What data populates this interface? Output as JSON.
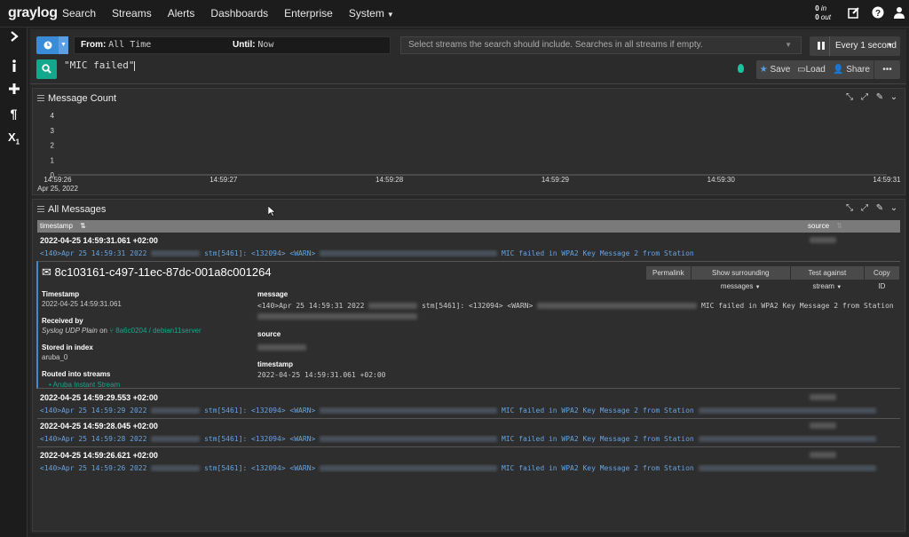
{
  "nav": {
    "logo_main": "gray",
    "logo_accent": "log",
    "items": [
      "Search",
      "Streams",
      "Alerts",
      "Dashboards",
      "Enterprise",
      "System"
    ],
    "throughput_in": "0",
    "throughput_in_label": "in",
    "throughput_out": "0",
    "throughput_out_label": "out"
  },
  "search": {
    "from_label": "From:",
    "from_value": "All Time",
    "until_label": "Until:",
    "until_value": "Now",
    "streams_placeholder": "Select streams the search should include. Searches in all streams if empty.",
    "refresh_label": "Every 1 second",
    "query": "\"MIC failed\"",
    "save_label": "Save",
    "load_label": "Load",
    "share_label": "Share",
    "more_label": "•••"
  },
  "message_count": {
    "title": "Message Count"
  },
  "chart_data": {
    "type": "line",
    "title": "Message Count",
    "y_ticks": [
      "4",
      "3",
      "2",
      "1",
      "0"
    ],
    "ylim": [
      0,
      4
    ],
    "x_ticks": [
      "14:59:26",
      "14:59:27",
      "14:59:28",
      "14:59:29",
      "14:59:30",
      "14:59:31"
    ],
    "x_subtitle": "Apr 25, 2022",
    "series": []
  },
  "all_messages": {
    "title": "All Messages",
    "col_timestamp": "timestamp",
    "col_source": "source",
    "first_row": {
      "timestamp": "2022-04-25 14:59:31.061 +02:00",
      "msg_start": "<140>Apr 25 14:59:31 2022",
      "msg_mid": "stm[5461]: <132094> <WARN>",
      "msg_tail": "MIC failed in WPA2 Key Message 2 from Station"
    },
    "detail": {
      "id": "8c103161-c497-11ec-87dc-001a8c001264",
      "buttons": [
        "Permalink",
        "Show surrounding messages",
        "Test against stream",
        "Copy ID"
      ],
      "timestamp_label": "Timestamp",
      "timestamp_value": "2022-04-25 14:59:31.061",
      "received_label": "Received by",
      "received_input": "Syslog UDP Plain",
      "received_on": "on",
      "received_node": "8a6c0204 / debian11server",
      "stored_label": "Stored in index",
      "stored_value": "aruba_0",
      "routed_label": "Routed into streams",
      "routed_stream": "Aruba Instant Stream",
      "message_label": "message",
      "message_start": "<140>Apr 25 14:59:31 2022",
      "message_mid": "stm[5461]: <132094> <WARN>",
      "message_tail": "MIC failed in WPA2 Key Message 2 from Station",
      "source_label": "source",
      "ts_label": "timestamp",
      "ts_value": "2022-04-25 14:59:31.061 +02:00"
    },
    "rows": [
      {
        "timestamp": "2022-04-25 14:59:29.553 +02:00",
        "msg_start": "<140>Apr 25 14:59:29 2022",
        "msg_mid": "stm[5461]: <132094> <WARN>",
        "msg_tail": "MIC failed in WPA2 Key Message 2 from Station"
      },
      {
        "timestamp": "2022-04-25 14:59:28.045 +02:00",
        "msg_start": "<140>Apr 25 14:59:28 2022",
        "msg_mid": "stm[5461]: <132094> <WARN>",
        "msg_tail": "MIC failed in WPA2 Key Message 2 from Station"
      },
      {
        "timestamp": "2022-04-25 14:59:26.621 +02:00",
        "msg_start": "<140>Apr 25 14:59:26 2022",
        "msg_mid": "stm[5461]: <132094> <WARN>",
        "msg_tail": "MIC failed in WPA2 Key Message 2 from Station"
      }
    ]
  },
  "colors": {
    "accent_blue": "#3a8cd8",
    "accent_green": "#13a88c",
    "message_blue": "#66a3e0",
    "logo_red": "#ff3633"
  }
}
